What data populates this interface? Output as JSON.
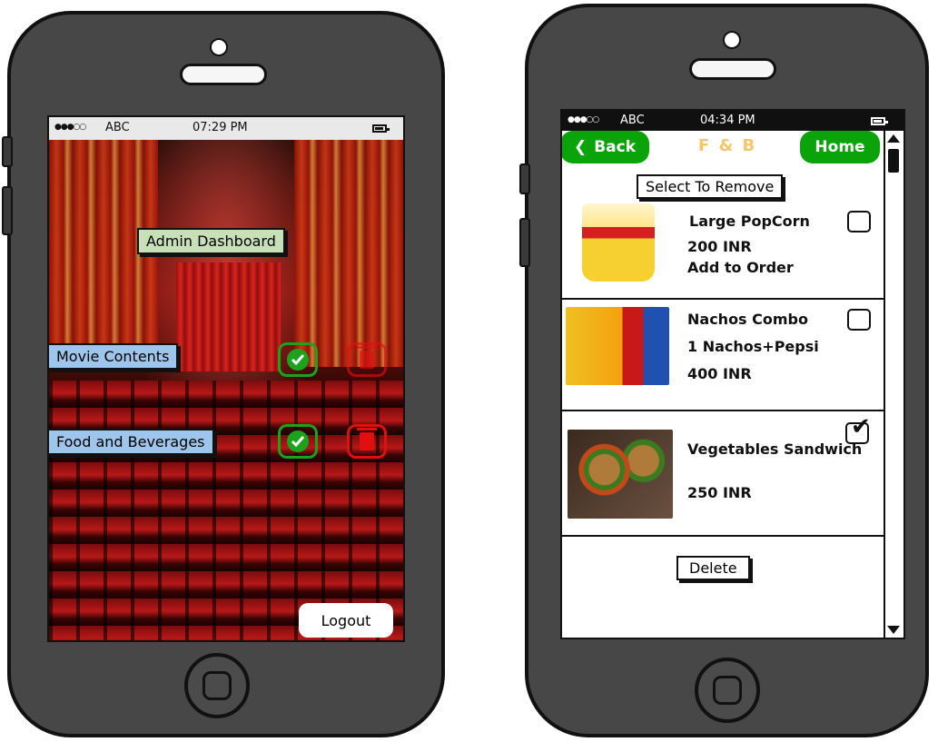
{
  "left_screen": {
    "status": {
      "signal": "●●●○○",
      "carrier": "ABC",
      "time": "07:29 PM"
    },
    "admin_dashboard_label": "Admin Dashboard",
    "rows": [
      {
        "label": "Movie Contents",
        "approve_icon": "check-circle-icon",
        "delete_icon": "trash-icon"
      },
      {
        "label": "Food and Beverages",
        "approve_icon": "check-circle-icon",
        "delete_icon": "trash-icon"
      }
    ],
    "logout_label": "Logout",
    "colors": {
      "approve": "#1ca21c",
      "delete": "#e01010",
      "label_blue": "#9ec6ec",
      "label_green": "#c7e0b8"
    }
  },
  "right_screen": {
    "status": {
      "signal": "●●●○○",
      "carrier": "ABC",
      "time": "04:34 PM"
    },
    "nav": {
      "back_label": "Back",
      "title": "F & B",
      "home_label": "Home"
    },
    "select_to_remove_label": "Select To Remove",
    "items": [
      {
        "line1": "Large PopCorn",
        "line2": "200 INR",
        "line3": "Add to Order",
        "checked": false
      },
      {
        "line1": "Nachos Combo",
        "line2": "1 Nachos+Pepsi",
        "line3": "400 INR",
        "checked": false
      },
      {
        "line1": "Vegetables Sandwich",
        "line2": "250 INR",
        "line3": "",
        "checked": true
      }
    ],
    "delete_label": "Delete",
    "colors": {
      "nav_green": "#0aa30a",
      "title_gold": "#f4c66a"
    }
  }
}
